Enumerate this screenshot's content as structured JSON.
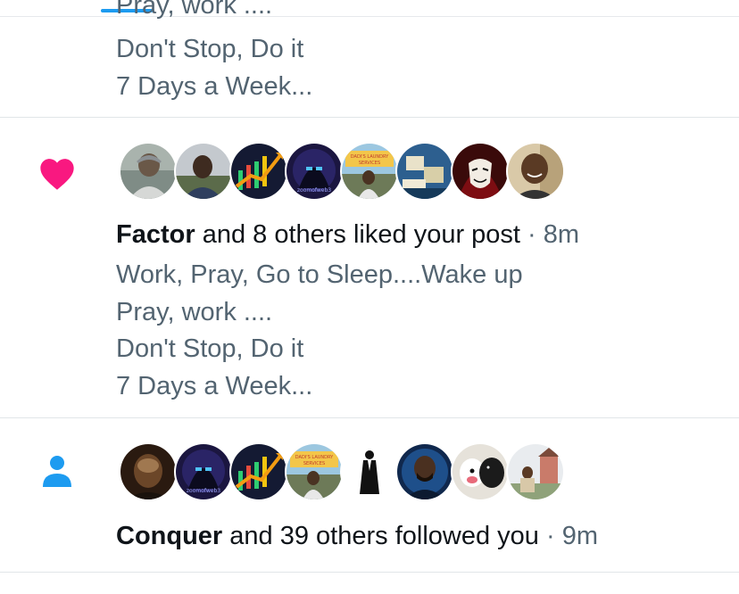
{
  "colors": {
    "accent": "#1d9bf0",
    "like": "#f91880",
    "text_primary": "#0f1419",
    "text_secondary": "#536471"
  },
  "notifications": [
    {
      "type": "like",
      "icon": "heart-icon",
      "post_lines": [
        "Pray, work  ....",
        "Don't Stop, Do it",
        "7 Days a Week..."
      ]
    },
    {
      "type": "like",
      "icon": "heart-icon",
      "actor": "Factor",
      "action": "and 8 others liked your post",
      "time": "· 8m",
      "avatars": [
        {
          "name": "avatar-person-grey-cap"
        },
        {
          "name": "avatar-person-selfie"
        },
        {
          "name": "avatar-crypto-chart"
        },
        {
          "name": "avatar-zoomofweb3-hooded",
          "text": "zoomofweb3"
        },
        {
          "name": "avatar-laundry-services",
          "text": "DADI'S LAUNDRY SERVICES"
        },
        {
          "name": "avatar-blue-scene"
        },
        {
          "name": "avatar-anonymous-mask"
        },
        {
          "name": "avatar-smiling-man"
        }
      ],
      "post_lines": [
        "Work, Pray, Go to Sleep....Wake up",
        "Pray, work  ....",
        "Don't Stop, Do it",
        "7 Days a Week..."
      ]
    },
    {
      "type": "follow",
      "icon": "person-icon",
      "actor": "Conquer",
      "action": "and 39 others followed you",
      "time": "· 9m",
      "avatars": [
        {
          "name": "avatar-dark-portrait"
        },
        {
          "name": "avatar-zoomofweb3-hooded",
          "text": "zoomofweb3"
        },
        {
          "name": "avatar-crypto-chart"
        },
        {
          "name": "avatar-laundry-services",
          "text": "DADI'S LAUNDRY SERVICES"
        },
        {
          "name": "avatar-silhouette-figure"
        },
        {
          "name": "avatar-bearded-man-blue"
        },
        {
          "name": "avatar-dogs"
        },
        {
          "name": "avatar-man-outdoors"
        }
      ]
    }
  ]
}
